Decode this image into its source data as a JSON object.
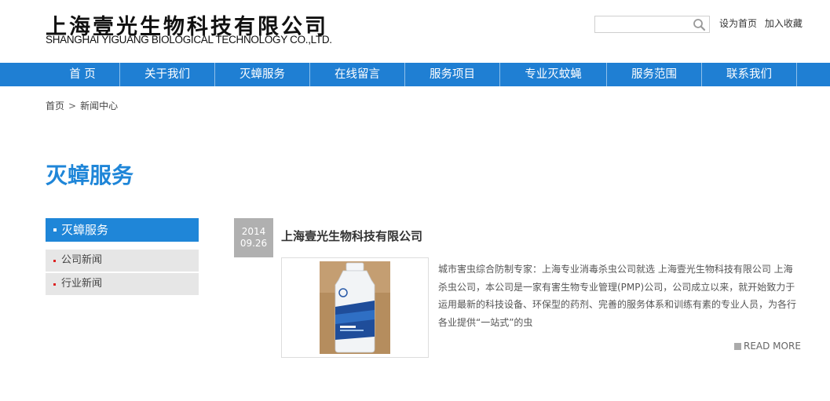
{
  "header": {
    "logo_cn": "上海壹光生物科技有限公司",
    "logo_en": "SHANGHAI YIGUANG BIOLOGICAL TECHNOLOGY CO.,LTD.",
    "search_value": "",
    "search_icon": "magnifier-icon",
    "links": {
      "set_home": "设为首页",
      "add_favorite": "加入收藏"
    }
  },
  "nav": {
    "items": [
      {
        "label": "首 页"
      },
      {
        "label": "关于我们"
      },
      {
        "label": "灭蟑服务"
      },
      {
        "label": "在线留言"
      },
      {
        "label": "服务项目"
      },
      {
        "label": "专业灭蚊蝇"
      },
      {
        "label": "服务范围"
      },
      {
        "label": "联系我们"
      }
    ]
  },
  "breadcrumb": {
    "home": "首页",
    "separator": ">",
    "current": "新闻中心"
  },
  "page_title": "灭蟑服务",
  "sidebar": {
    "header": "灭蟑服务",
    "items": [
      {
        "label": "公司新闻"
      },
      {
        "label": "行业新闻"
      }
    ]
  },
  "article": {
    "year": "2014",
    "date": "09.26",
    "title": "上海壹光生物科技有限公司",
    "description": "城市害虫综合防制专家：上海专业消毒杀虫公司就选 上海壹光生物科技有限公司 上海杀虫公司，本公司是一家有害生物专业管理(PMP)公司，公司成立以来，就开始致力于运用最新的科技设备、环保型的药剂、完善的服务体系和训练有素的专业人员，为各行各业提供“一站式”的虫",
    "read_more": "READ MORE"
  },
  "colors": {
    "nav_bg": "#1f7fd3",
    "accent": "#1f86d8",
    "sidebar_item_bg": "#e6e6e6",
    "date_bg": "#b0b0b0"
  }
}
